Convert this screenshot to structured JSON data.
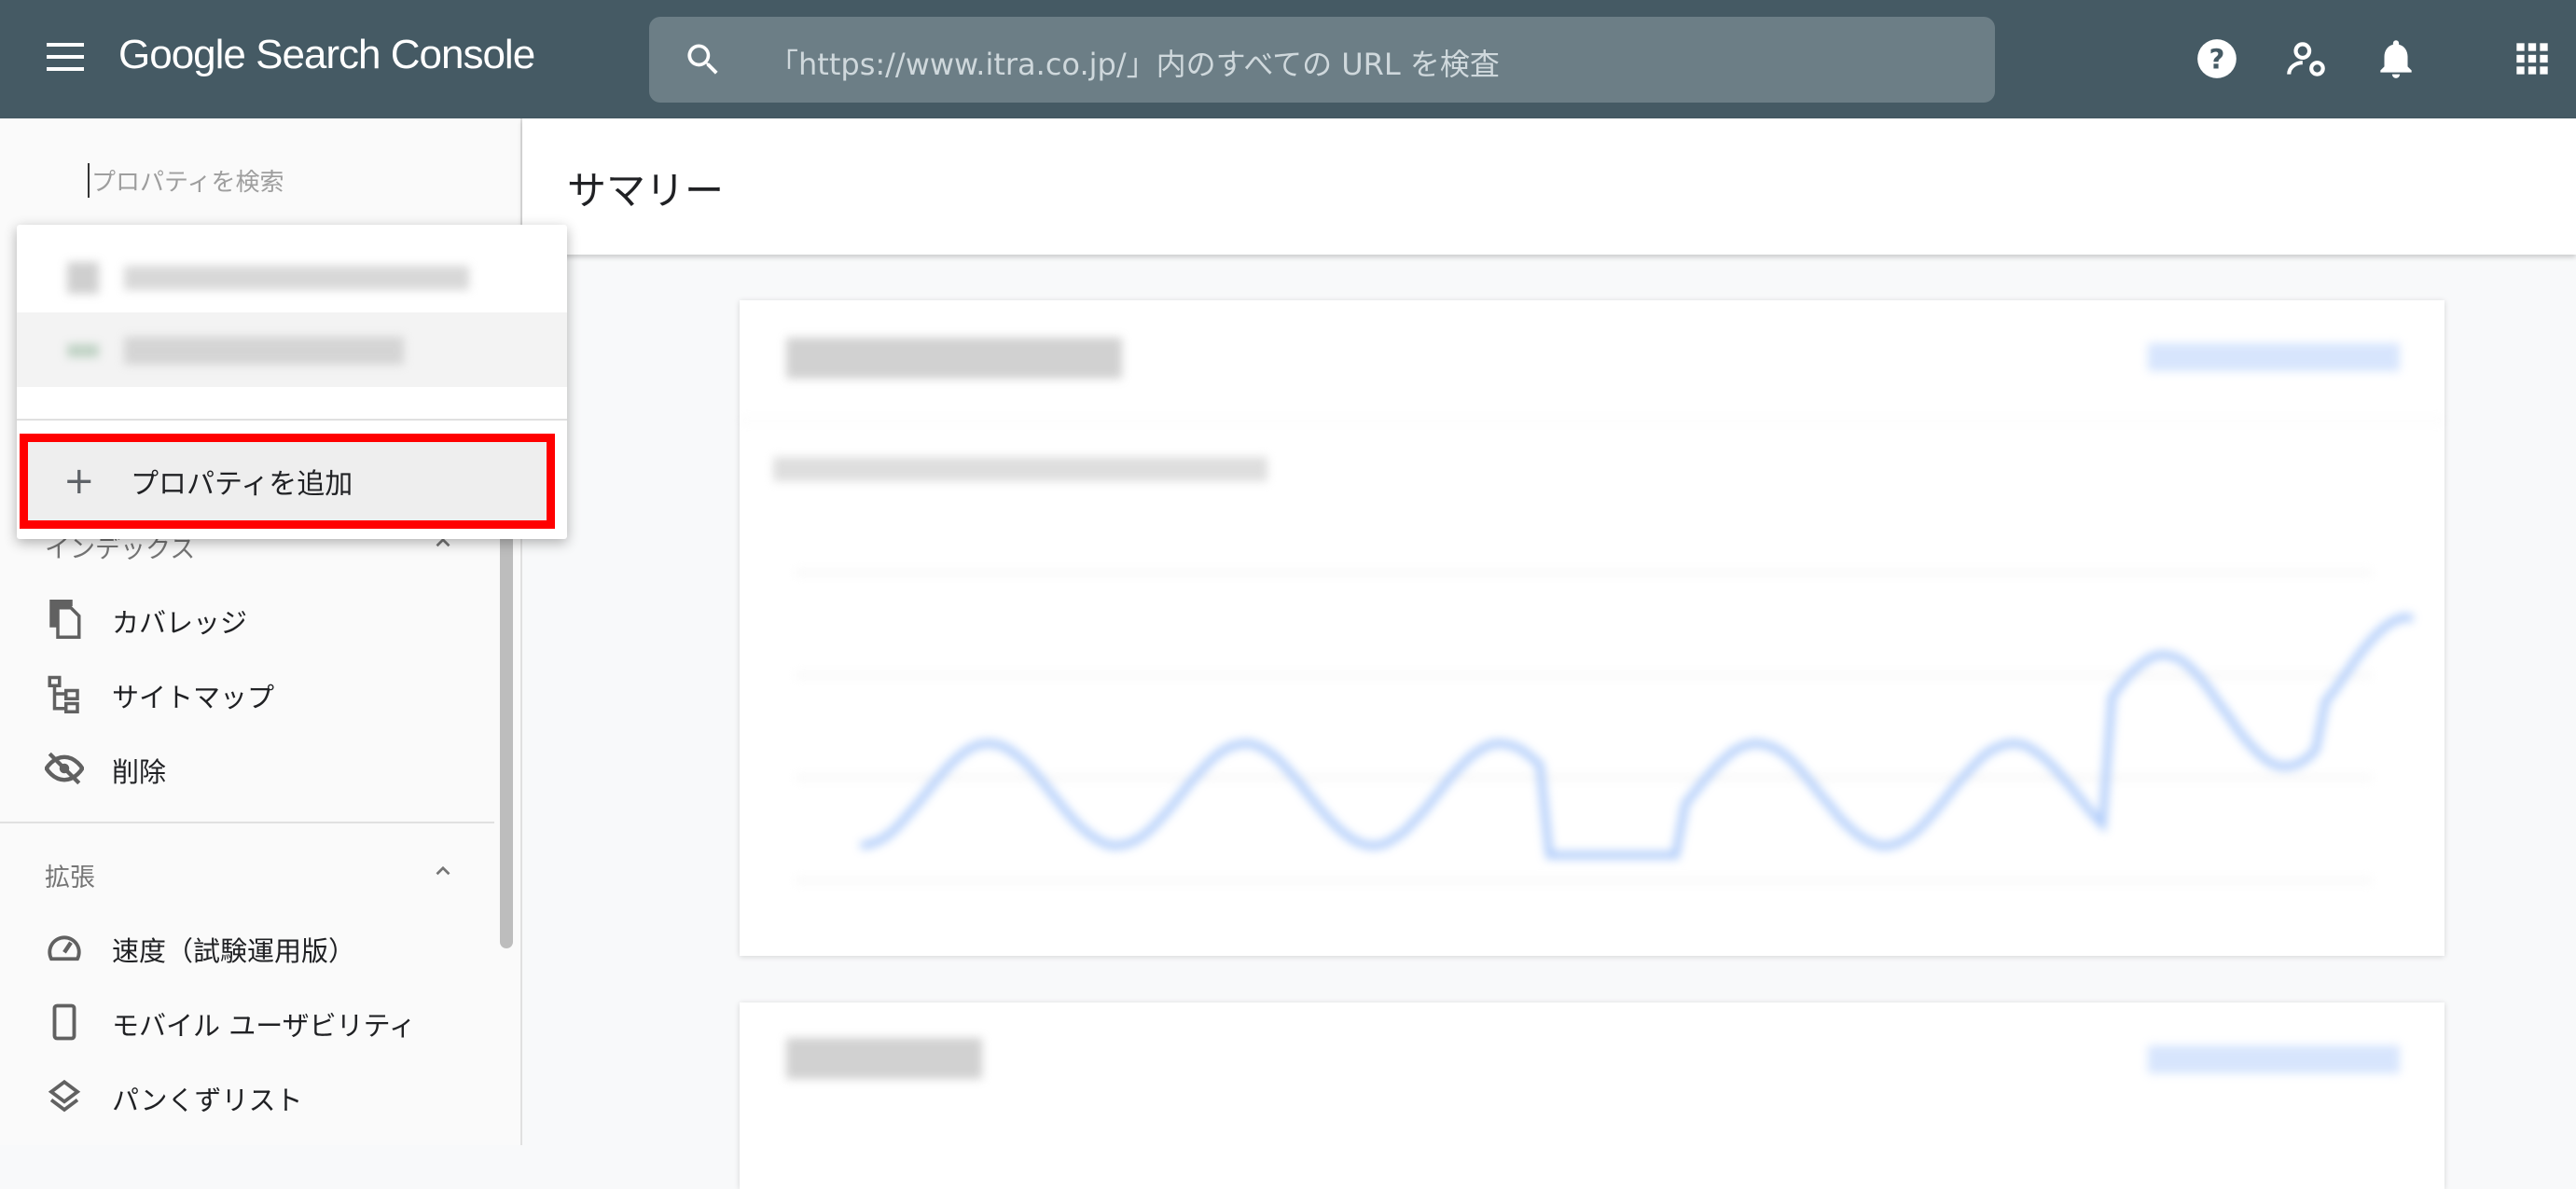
{
  "header": {
    "app_title": "Google Search Console",
    "search_placeholder": "「https://www.itra.co.jp/」内のすべての URL を検査",
    "icons": [
      "menu-icon",
      "search-icon",
      "help-icon",
      "admin-settings-icon",
      "notifications-icon",
      "apps-icon"
    ]
  },
  "sidebar": {
    "property_search_placeholder": "プロパティを検索",
    "sections": [
      {
        "label": "インデックス",
        "items": [
          {
            "label": "カバレッジ",
            "icon": "file-copy-icon"
          },
          {
            "label": "サイトマップ",
            "icon": "sitemap-icon"
          },
          {
            "label": "削除",
            "icon": "visibility-off-icon"
          }
        ]
      },
      {
        "label": "拡張",
        "items": [
          {
            "label": "速度（試験運用版）",
            "icon": "speed-icon"
          },
          {
            "label": "モバイル ユーザビリティ",
            "icon": "smartphone-icon"
          },
          {
            "label": "パンくずリスト",
            "icon": "layers-icon"
          }
        ]
      }
    ]
  },
  "property_dropdown": {
    "add_property_label": "プロパティを追加",
    "highlight_color": "#ff0000"
  },
  "main": {
    "page_title": "サマリー"
  },
  "colors": {
    "header": "#455a64",
    "search_box": "#6c7e86",
    "chart_line": "#8ab4f8"
  }
}
